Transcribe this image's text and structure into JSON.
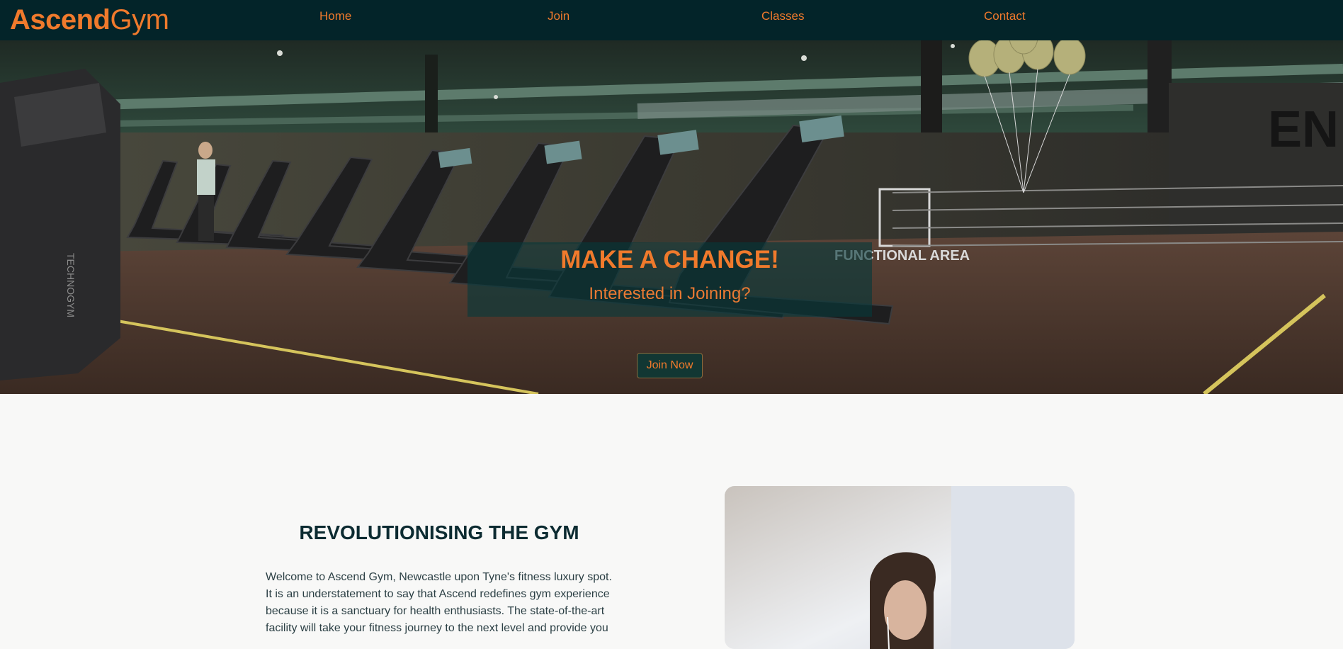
{
  "brand": {
    "bold": "Ascend",
    "light": "Gym"
  },
  "nav": {
    "home": "Home",
    "join": "Join",
    "classes": "Classes",
    "contact": "Contact"
  },
  "hero": {
    "title": "MAKE A CHANGE!",
    "subtitle": "Interested in Joining?",
    "button": "Join Now",
    "wall_sign": "FUNCTIONAL AREA",
    "treadmill_brand": "TECHNOGYM"
  },
  "about": {
    "title": "REVOLUTIONISING THE GYM",
    "body": "Welcome to Ascend Gym, Newcastle upon Tyne's fitness luxury spot. It is an understatement to say that Ascend redefines gym experience because it is a sanctuary for health enthusiasts. The state-of-the-art facility will take your fitness journey to the next level and provide you"
  },
  "colors": {
    "accent": "#f07a2c",
    "nav_bg": "#032429",
    "page_bg": "#f8f8f7",
    "heading": "#0c2b31",
    "panel": "#06393a"
  }
}
